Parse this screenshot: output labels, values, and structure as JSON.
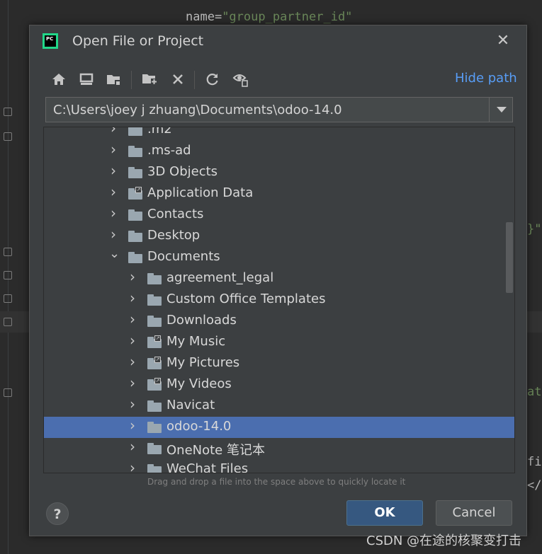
{
  "editor": {
    "code_attr": "name=",
    "code_string": "\"group_partner_id\"",
    "right_fragments": [
      "}\"",
      "at",
      "fi",
      "</"
    ]
  },
  "dialog": {
    "title": "Open File or Project",
    "app_icon_text": "PC",
    "close_icon": "close-icon",
    "toolbar": [
      {
        "name": "home-icon",
        "glyph": "⌂"
      },
      {
        "name": "desktop-icon",
        "glyph": "▭"
      },
      {
        "name": "project-folder-icon",
        "glyph": "▆"
      },
      {
        "name": "new-folder-icon",
        "glyph": "▆"
      },
      {
        "name": "delete-icon",
        "glyph": "✕"
      },
      {
        "name": "refresh-icon",
        "glyph": "⟳"
      },
      {
        "name": "show-hidden-icon",
        "glyph": "◉"
      }
    ],
    "hide_path_label": "Hide path",
    "path_value": "C:\\Users\\joey j zhuang\\Documents\\odoo-14.0",
    "tree": [
      {
        "label": ".m2",
        "level": 1,
        "expanded": false,
        "link": false,
        "selected": false
      },
      {
        "label": ".ms-ad",
        "level": 1,
        "expanded": false,
        "link": false,
        "selected": false
      },
      {
        "label": "3D Objects",
        "level": 1,
        "expanded": false,
        "link": false,
        "selected": false
      },
      {
        "label": "Application Data",
        "level": 1,
        "expanded": false,
        "link": true,
        "selected": false
      },
      {
        "label": "Contacts",
        "level": 1,
        "expanded": false,
        "link": false,
        "selected": false
      },
      {
        "label": "Desktop",
        "level": 1,
        "expanded": false,
        "link": false,
        "selected": false
      },
      {
        "label": "Documents",
        "level": 1,
        "expanded": true,
        "link": false,
        "selected": false
      },
      {
        "label": "agreement_legal",
        "level": 2,
        "expanded": false,
        "link": false,
        "selected": false
      },
      {
        "label": "Custom Office Templates",
        "level": 2,
        "expanded": false,
        "link": false,
        "selected": false
      },
      {
        "label": "Downloads",
        "level": 2,
        "expanded": false,
        "link": false,
        "selected": false
      },
      {
        "label": "My Music",
        "level": 2,
        "expanded": false,
        "link": true,
        "selected": false
      },
      {
        "label": "My Pictures",
        "level": 2,
        "expanded": false,
        "link": true,
        "selected": false
      },
      {
        "label": "My Videos",
        "level": 2,
        "expanded": false,
        "link": true,
        "selected": false
      },
      {
        "label": "Navicat",
        "level": 2,
        "expanded": false,
        "link": false,
        "selected": false
      },
      {
        "label": "odoo-14.0",
        "level": 2,
        "expanded": false,
        "link": false,
        "selected": true
      },
      {
        "label": "OneNote 笔记本",
        "level": 2,
        "expanded": false,
        "link": false,
        "selected": false
      },
      {
        "label": "WeChat Files",
        "level": 2,
        "expanded": false,
        "link": false,
        "selected": false
      }
    ],
    "hint": "Drag and drop a file into the space above to quickly locate it",
    "help_label": "?",
    "ok_label": "OK",
    "cancel_label": "Cancel"
  },
  "watermark": "CSDN @在途的核聚变打击",
  "colors": {
    "selection": "#4b6eaf",
    "link": "#589df6",
    "ok_button": "#365880",
    "dialog_bg": "#3c3f41",
    "editor_bg": "#2b2b2b"
  }
}
